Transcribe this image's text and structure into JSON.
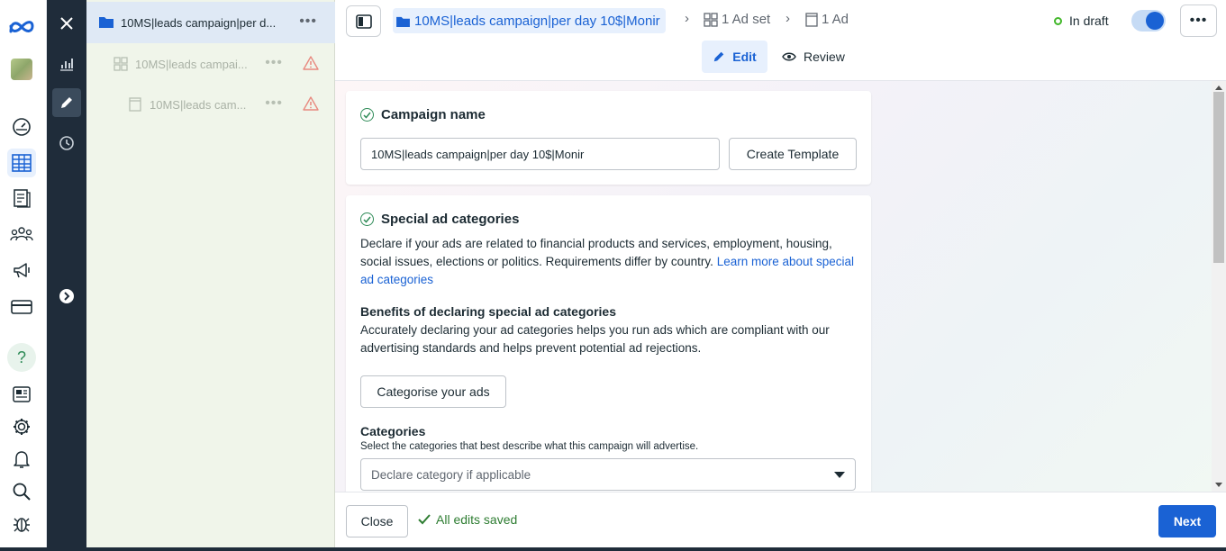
{
  "global_nav": {
    "items": [
      "meta-logo",
      "account-avatar",
      "dashboard-icon",
      "ads-manager-icon",
      "pages-icon",
      "audiences-icon",
      "campaigns-megaphone-icon",
      "billing-icon",
      "help-icon",
      "news-icon",
      "settings-icon",
      "notifications-icon",
      "search-icon",
      "bug-report-icon"
    ],
    "help_label": "?"
  },
  "tool_column": {
    "close": "close-icon",
    "items": [
      "charts-icon",
      "edit-icon",
      "history-icon",
      "expand-icon"
    ]
  },
  "tree": {
    "campaign_label": "10MS|leads campaign|per d...",
    "adset_label": "10MS|leads campai...",
    "ad_label": "10MS|leads cam..."
  },
  "topbar": {
    "campaign_crumb": "10MS|leads campaign|per day 10$|Monir",
    "adset_crumb": "1 Ad set",
    "ad_crumb": "1 Ad",
    "status": "In draft",
    "edit_label": "Edit",
    "review_label": "Review"
  },
  "campaign_card": {
    "title": "Campaign name",
    "name_value": "10MS|leads campaign|per day 10$|Monir",
    "create_template_label": "Create Template"
  },
  "special_card": {
    "title": "Special ad categories",
    "description": "Declare if your ads are related to financial products and services, employment, housing, social issues, elections or politics. Requirements differ by country.",
    "learn_more_link": "Learn more about special ad categories",
    "benefits_heading": "Benefits of declaring special ad categories",
    "benefits_text": "Accurately declaring your ad categories helps you run ads which are compliant with our advertising standards and helps prevent potential ad rejections.",
    "categorise_button": "Categorise your ads",
    "categories_heading": "Categories",
    "categories_hint": "Select the categories that best describe what this campaign will advertise.",
    "categories_placeholder": "Declare category if applicable"
  },
  "footer": {
    "close_label": "Close",
    "saved_label": "All edits saved",
    "next_label": "Next"
  },
  "colors": {
    "accent": "#1a62d4",
    "dark_column": "#1f2c3a",
    "tree_bg": "#f0f5ea",
    "success": "#2e7d32",
    "warning": "#e04b3c"
  }
}
